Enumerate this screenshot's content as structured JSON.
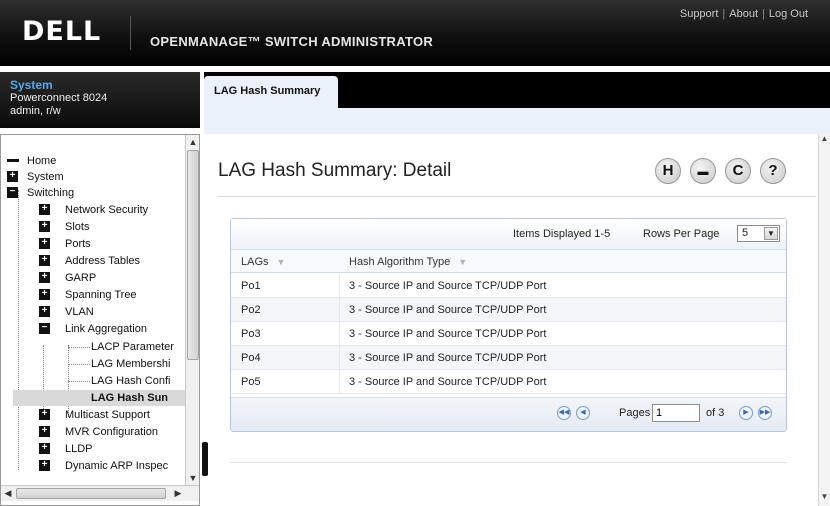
{
  "header": {
    "logo": "DELL",
    "app_title": "OPENMANAGE™ SWITCH ADMINISTRATOR",
    "links": [
      "Support",
      "About",
      "Log Out"
    ],
    "separator": "|"
  },
  "system_box": {
    "title": "System",
    "model": "Powerconnect 8024",
    "user": "admin, r/w"
  },
  "tree": {
    "items": [
      {
        "label": "Home",
        "toggle": ""
      },
      {
        "label": "System",
        "toggle": "+"
      },
      {
        "label": "Switching",
        "toggle": "−"
      },
      {
        "label": "Network Security",
        "toggle": "+"
      },
      {
        "label": "Slots",
        "toggle": "+"
      },
      {
        "label": "Ports",
        "toggle": "+"
      },
      {
        "label": "Address Tables",
        "toggle": "+"
      },
      {
        "label": "GARP",
        "toggle": "+"
      },
      {
        "label": "Spanning Tree",
        "toggle": "+"
      },
      {
        "label": "VLAN",
        "toggle": "+"
      },
      {
        "label": "Link Aggregation",
        "toggle": "−"
      },
      {
        "label": "LACP Parameter",
        "toggle": ""
      },
      {
        "label": "LAG Membershi",
        "toggle": ""
      },
      {
        "label": "LAG Hash Confi",
        "toggle": ""
      },
      {
        "label": "LAG Hash Sun",
        "toggle": ""
      },
      {
        "label": "Multicast Support",
        "toggle": "+"
      },
      {
        "label": "MVR Configuration",
        "toggle": "+"
      },
      {
        "label": "LLDP",
        "toggle": "+"
      },
      {
        "label": "Dynamic ARP Inspec",
        "toggle": "+"
      }
    ],
    "selected": "LAG Hash Sun"
  },
  "tabs": {
    "active": "LAG Hash Summary"
  },
  "main": {
    "page_title": "LAG Hash Summary: Detail",
    "toolbar_icons": [
      "save-icon",
      "print-icon",
      "refresh-icon",
      "help-icon"
    ],
    "toolbar_glyphs": [
      "H",
      "▬",
      "C",
      "?"
    ]
  },
  "grid": {
    "items_displayed": "Items Displayed 1-5",
    "rows_per_page_label": "Rows Per Page",
    "rows_per_page_value": "5",
    "columns": [
      "LAGs",
      "Hash Algorithm Type"
    ],
    "rows": [
      [
        "Po1",
        "3 - Source IP and Source TCP/UDP Port"
      ],
      [
        "Po2",
        "3 - Source IP and Source TCP/UDP Port"
      ],
      [
        "Po3",
        "3 - Source IP and Source TCP/UDP Port"
      ],
      [
        "Po4",
        "3 - Source IP and Source TCP/UDP Port"
      ],
      [
        "Po5",
        "3 - Source IP and Source TCP/UDP Port"
      ]
    ],
    "pager": {
      "pages_label": "Pages",
      "current_page": "1",
      "of_label": "of 3"
    }
  },
  "colors": {
    "header_bg": "#000000",
    "accent_blue": "#5aa7e6",
    "content_band": "#eaf1fb"
  }
}
